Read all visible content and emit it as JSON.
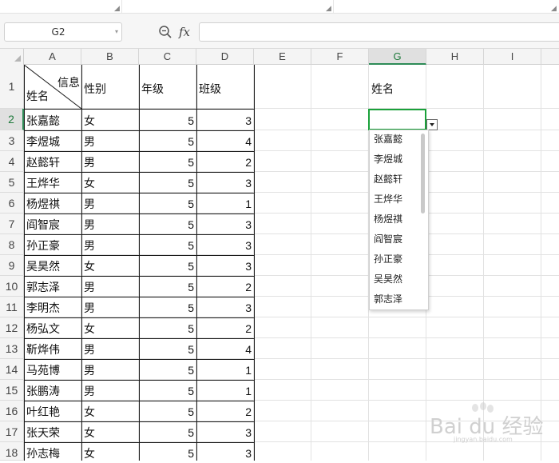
{
  "formula_bar": {
    "name_box": "G2",
    "fx_label": "fx",
    "formula_value": ""
  },
  "columns": [
    "A",
    "B",
    "C",
    "D",
    "E",
    "F",
    "G",
    "H",
    "I"
  ],
  "rows": [
    "1",
    "2",
    "3",
    "4",
    "5",
    "6",
    "7",
    "8",
    "9",
    "10",
    "11",
    "12",
    "13",
    "14",
    "15",
    "16",
    "17",
    "18"
  ],
  "active_cell": {
    "column": "G",
    "row": "2"
  },
  "table": {
    "header_diagonal": {
      "top_right": "信息",
      "bottom_left": "姓名"
    },
    "headers": {
      "gender": "性别",
      "grade": "年级",
      "class": "班级"
    },
    "records": [
      {
        "name": "张嘉懿",
        "gender": "女",
        "grade": "5",
        "class": "3"
      },
      {
        "name": "李煜城",
        "gender": "男",
        "grade": "5",
        "class": "4"
      },
      {
        "name": "赵懿轩",
        "gender": "男",
        "grade": "5",
        "class": "2"
      },
      {
        "name": "王烨华",
        "gender": "女",
        "grade": "5",
        "class": "3"
      },
      {
        "name": "杨煜祺",
        "gender": "男",
        "grade": "5",
        "class": "1"
      },
      {
        "name": "阎智宸",
        "gender": "男",
        "grade": "5",
        "class": "3"
      },
      {
        "name": "孙正豪",
        "gender": "男",
        "grade": "5",
        "class": "3"
      },
      {
        "name": "吴昊然",
        "gender": "女",
        "grade": "5",
        "class": "3"
      },
      {
        "name": "郭志泽",
        "gender": "男",
        "grade": "5",
        "class": "2"
      },
      {
        "name": "李明杰",
        "gender": "男",
        "grade": "5",
        "class": "3"
      },
      {
        "name": "杨弘文",
        "gender": "女",
        "grade": "5",
        "class": "2"
      },
      {
        "name": "靳烨伟",
        "gender": "男",
        "grade": "5",
        "class": "4"
      },
      {
        "name": "马苑博",
        "gender": "男",
        "grade": "5",
        "class": "1"
      },
      {
        "name": "张鹏涛",
        "gender": "男",
        "grade": "5",
        "class": "1"
      },
      {
        "name": "叶红艳",
        "gender": "女",
        "grade": "5",
        "class": "2"
      },
      {
        "name": "张天荣",
        "gender": "女",
        "grade": "5",
        "class": "3"
      },
      {
        "name": "孙志梅",
        "gender": "女",
        "grade": "5",
        "class": "3"
      }
    ]
  },
  "g_column": {
    "header_label": "姓名"
  },
  "dropdown": {
    "options": [
      "张嘉懿",
      "李煜城",
      "赵懿轩",
      "王烨华",
      "杨煜祺",
      "阎智宸",
      "孙正豪",
      "吴昊然",
      "郭志泽"
    ]
  },
  "watermark": {
    "text": "Bai du 经验",
    "sub": "jingyan.baidu.com"
  },
  "colors": {
    "selection_green": "#1aa13a",
    "header_bg": "#f4f4f4"
  }
}
